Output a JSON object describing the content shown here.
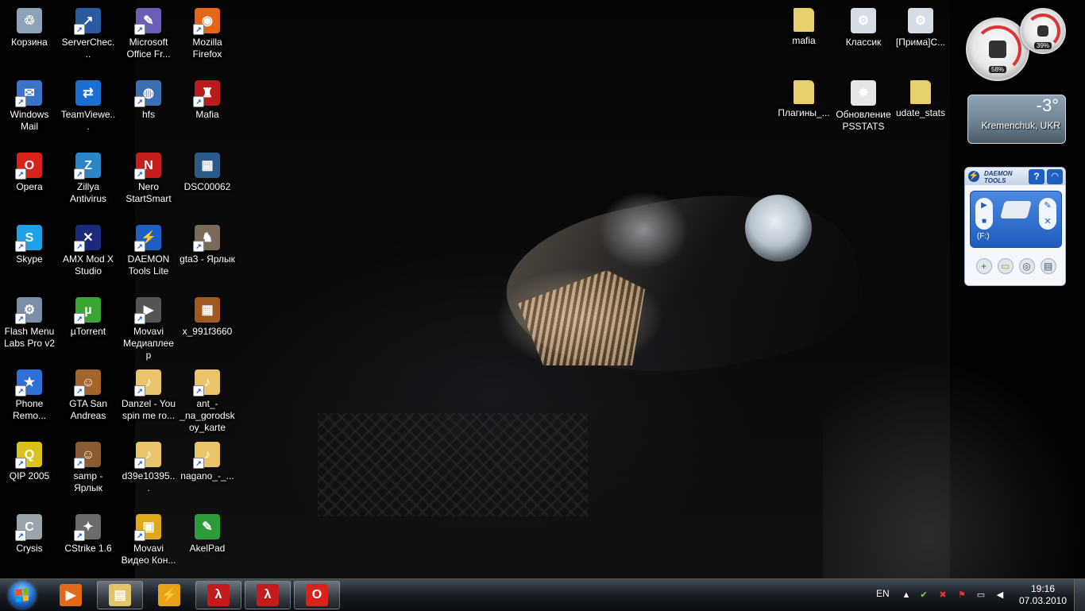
{
  "desktop": {
    "icons": [
      {
        "label": "Корзина",
        "icon": "recycle-bin-icon",
        "color": "#8fa3b8",
        "glyph": "♲",
        "shortcut": false
      },
      {
        "label": "Windows Mail",
        "icon": "windows-mail-icon",
        "color": "#3a73c9",
        "glyph": "✉",
        "shortcut": true
      },
      {
        "label": "Opera",
        "icon": "opera-icon",
        "color": "#d8231c",
        "glyph": "O",
        "shortcut": true
      },
      {
        "label": "Skype",
        "icon": "skype-icon",
        "color": "#1ea1e8",
        "glyph": "S",
        "shortcut": true
      },
      {
        "label": "Flash Menu Labs Pro v2",
        "icon": "flash-menu-icon",
        "color": "#7b8ea6",
        "glyph": "⚙",
        "shortcut": true
      },
      {
        "label": "Phone Remo...",
        "icon": "phone-remote-icon",
        "color": "#2e6fd8",
        "glyph": "★",
        "shortcut": true
      },
      {
        "label": "QIP 2005",
        "icon": "qip-icon",
        "color": "#d9c21c",
        "glyph": "Q",
        "shortcut": true
      },
      {
        "label": "Crysis",
        "icon": "crysis-icon",
        "color": "#9aa4ad",
        "glyph": "C",
        "shortcut": true
      },
      {
        "label": "ServerChec...",
        "icon": "server-check-icon",
        "color": "#2a5aa0",
        "glyph": "↗",
        "shortcut": true
      },
      {
        "label": "TeamViewe...",
        "icon": "teamviewer-icon",
        "color": "#1a6fd1",
        "glyph": "⇄",
        "shortcut": false
      },
      {
        "label": "Zillya Antivirus",
        "icon": "zillya-icon",
        "color": "#2b86c9",
        "glyph": "Z",
        "shortcut": true
      },
      {
        "label": "AMX Mod X Studio",
        "icon": "amx-mod-icon",
        "color": "#1b2a7a",
        "glyph": "✕",
        "shortcut": true
      },
      {
        "label": "µTorrent",
        "icon": "utorrent-icon",
        "color": "#3aa532",
        "glyph": "µ",
        "shortcut": true
      },
      {
        "label": "GTA San Andreas",
        "icon": "gta-sa-icon",
        "color": "#a3652c",
        "glyph": "☺",
        "shortcut": true
      },
      {
        "label": "samp - Ярлык",
        "icon": "samp-icon",
        "color": "#8a5a30",
        "glyph": "☺",
        "shortcut": true
      },
      {
        "label": "CStrike 1.6",
        "icon": "cstrike-icon",
        "color": "#6b6b6b",
        "glyph": "✦",
        "shortcut": true
      },
      {
        "label": "Microsoft Office Fr...",
        "icon": "office-icon",
        "color": "#6b5fb5",
        "glyph": "✎",
        "shortcut": true
      },
      {
        "label": "hfs",
        "icon": "hfs-icon",
        "color": "#3c6fb2",
        "glyph": "◍",
        "shortcut": true
      },
      {
        "label": "Nero StartSmart",
        "icon": "nero-icon",
        "color": "#c41e1e",
        "glyph": "N",
        "shortcut": true
      },
      {
        "label": "DAEMON Tools Lite",
        "icon": "daemon-tools-icon",
        "color": "#1f5fc4",
        "glyph": "⚡",
        "shortcut": true
      },
      {
        "label": "Movavi Медиаплеер",
        "icon": "movavi-player-icon",
        "color": "#555555",
        "glyph": "▶",
        "shortcut": true
      },
      {
        "label": "Danzel - You spin me ro...",
        "icon": "audio-file-icon",
        "color": "#e9c46a",
        "glyph": "♪",
        "shortcut": true
      },
      {
        "label": "d39e10395...",
        "icon": "audio-file-icon",
        "color": "#e9c46a",
        "glyph": "♪",
        "shortcut": true
      },
      {
        "label": "Movavi Видео Кон...",
        "icon": "movavi-converter-icon",
        "color": "#e0a91c",
        "glyph": "▣",
        "shortcut": true
      },
      {
        "label": "Mozilla Firefox",
        "icon": "firefox-icon",
        "color": "#e5661b",
        "glyph": "◉",
        "shortcut": true
      },
      {
        "label": "Mafia",
        "icon": "mafia-icon",
        "color": "#b81c1c",
        "glyph": "♜",
        "shortcut": true
      },
      {
        "label": "DSC00062",
        "icon": "image-file-icon",
        "color": "#2c5b8a",
        "glyph": "▦",
        "shortcut": false
      },
      {
        "label": "gta3 - Ярлык",
        "icon": "gta3-icon",
        "color": "#7a6a5a",
        "glyph": "♞",
        "shortcut": true
      },
      {
        "label": "x_991f3660",
        "icon": "image-file-icon",
        "color": "#a05a20",
        "glyph": "▦",
        "shortcut": false
      },
      {
        "label": "ant_-_na_gorodskoy_karte",
        "icon": "audio-file-icon",
        "color": "#e9c46a",
        "glyph": "♪",
        "shortcut": true
      },
      {
        "label": "nagano_-_...",
        "icon": "audio-file-icon",
        "color": "#e9c46a",
        "glyph": "♪",
        "shortcut": true
      },
      {
        "label": "AkelPad",
        "icon": "akelpad-icon",
        "color": "#2f9a3a",
        "glyph": "✎",
        "shortcut": false
      },
      {
        "label": "mafia",
        "icon": "folder-icon",
        "color": "#e8cf6e",
        "glyph": "",
        "shortcut": false
      },
      {
        "label": "Плагины_...",
        "icon": "folder-icon",
        "color": "#e8cf6e",
        "glyph": "",
        "shortcut": false
      },
      {
        "label": "Классик",
        "icon": "settings-file-icon",
        "color": "#d6dde6",
        "glyph": "⚙",
        "shortcut": false
      },
      {
        "label": "Обновление PSSTATS",
        "icon": "update-file-icon",
        "color": "#e6e6e6",
        "glyph": "✸",
        "shortcut": false
      },
      {
        "label": "[Прима]С...",
        "icon": "settings-file-icon",
        "color": "#d6dde6",
        "glyph": "⚙",
        "shortcut": false
      },
      {
        "label": "udate_stats",
        "icon": "folder-icon",
        "color": "#e8cf6e",
        "glyph": "",
        "shortcut": false
      }
    ]
  },
  "gadgets": {
    "cpu_meter": {
      "cpu_percent": "58%",
      "memory_percent": "39%"
    },
    "weather": {
      "temperature": "-3°",
      "city": "Kremenchuk, UKR"
    },
    "daemon_tools": {
      "title_line1": "DAEMON",
      "title_line2": "TOOLS",
      "help": "?",
      "drive_letter": "(F:)"
    }
  },
  "taskbar": {
    "pinned": [
      {
        "name": "media-player-icon",
        "color": "#e06a1a",
        "glyph": "▶",
        "open": false
      },
      {
        "name": "explorer-icon",
        "color": "#e1c46a",
        "glyph": "▤",
        "open": true
      },
      {
        "name": "winamp-icon",
        "color": "#e7a21c",
        "glyph": "⚡",
        "open": false
      },
      {
        "name": "half-life-icon",
        "color": "#c41c1c",
        "glyph": "λ",
        "open": true
      },
      {
        "name": "half-life-icon",
        "color": "#c41c1c",
        "glyph": "λ",
        "open": true
      },
      {
        "name": "opera-icon",
        "color": "#d8231c",
        "glyph": "O",
        "open": true
      }
    ],
    "tray": {
      "language": "EN",
      "time": "19:16",
      "date": "07.03.2010"
    }
  }
}
